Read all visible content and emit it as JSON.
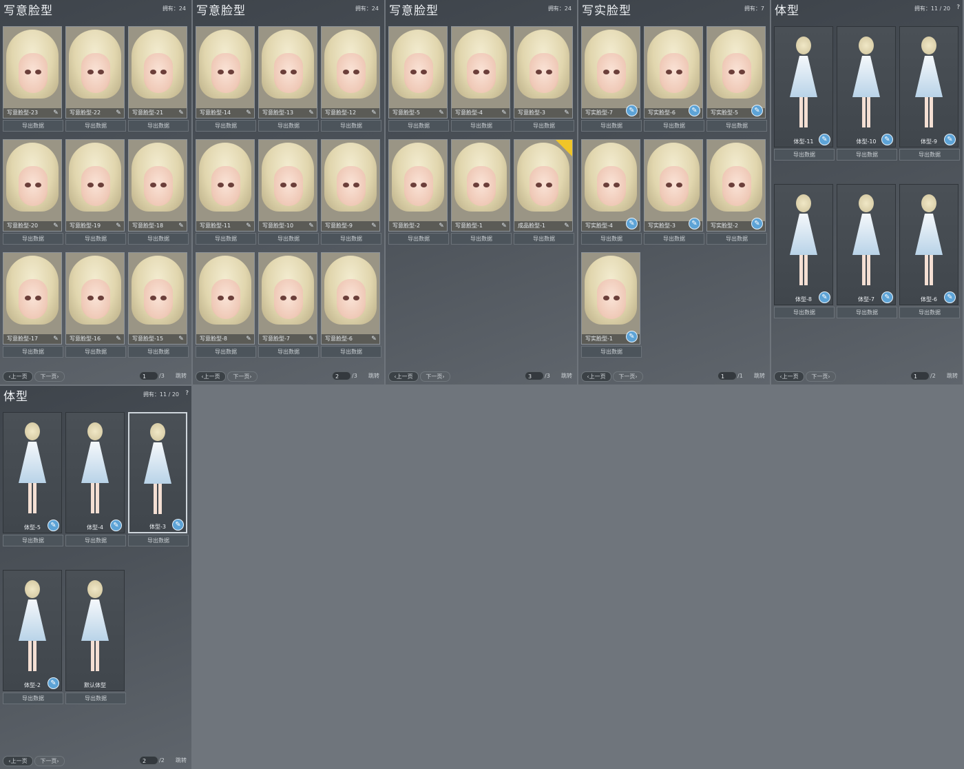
{
  "panels": [
    {
      "id": "p1",
      "title": "写意脸型",
      "count": "拥有：24",
      "kind": "face",
      "cards": [
        "写意脸型-23",
        "写意脸型-22",
        "写意脸型-21",
        "写意脸型-20",
        "写意脸型-19",
        "写意脸型-18",
        "写意脸型-17",
        "写意脸型-16",
        "写意脸型-15"
      ],
      "export_label": "导出数据",
      "pager": {
        "prev": "上一页",
        "next": "下一页",
        "page": "1",
        "total": "/3",
        "jump": "跳转"
      }
    },
    {
      "id": "p2",
      "title": "写意脸型",
      "count": "拥有：24",
      "kind": "face",
      "cards": [
        "写意脸型-14",
        "写意脸型-13",
        "写意脸型-12",
        "写意脸型-11",
        "写意脸型-10",
        "写意脸型-9",
        "写意脸型-8",
        "写意脸型-7",
        "写意脸型-6"
      ],
      "export_label": "导出数据",
      "pager": {
        "prev": "上一页",
        "next": "下一页",
        "page": "2",
        "total": "/3",
        "jump": "跳转"
      }
    },
    {
      "id": "p3",
      "title": "写意脸型",
      "count": "拥有：24",
      "kind": "face",
      "cards": [
        "写意脸型-5",
        "写意脸型-4",
        "写意脸型-3",
        "写意脸型-2",
        "写意脸型-1",
        "成品脸型-1"
      ],
      "export_label": "导出数据",
      "pager": {
        "prev": "上一页",
        "next": "下一页",
        "page": "3",
        "total": "/3",
        "jump": "跳转"
      }
    },
    {
      "id": "p4",
      "title": "写实脸型",
      "count": "拥有：7",
      "kind": "face-real",
      "cards": [
        "写实脸型-7",
        "写实脸型-6",
        "写实脸型-5",
        "写实脸型-4",
        "写实脸型-3",
        "写实脸型-2",
        "写实脸型-1"
      ],
      "export_label": "导出数据",
      "pager": {
        "prev": "上一页",
        "next": "下一页",
        "page": "1",
        "total": "/1",
        "jump": "跳转"
      }
    },
    {
      "id": "p5",
      "title": "体型",
      "count": "拥有：11 / 20",
      "kind": "body",
      "cards": [
        "体型-11",
        "体型-10",
        "体型-9",
        "体型-8",
        "体型-7",
        "体型-6"
      ],
      "export_label": "导出数据",
      "help": "?",
      "pager": {
        "prev": "上一页",
        "next": "下一页",
        "page": "1",
        "total": "/2",
        "jump": "跳转"
      }
    },
    {
      "id": "p6",
      "title": "体型",
      "count": "拥有：11 / 20",
      "kind": "body",
      "cards": [
        "体型-5",
        "体型-4",
        "体型-3",
        "体型-2",
        "默认体型"
      ],
      "export_label": "导出数据",
      "help": "?",
      "pager": {
        "prev": "上一页",
        "next": "下一页",
        "page": "2",
        "total": "/2",
        "jump": "跳转"
      }
    }
  ],
  "badge_text": "成品",
  "colors": {
    "background": "#6f757c",
    "edit_round": "#5da3d6",
    "badge": "#f0c528"
  }
}
